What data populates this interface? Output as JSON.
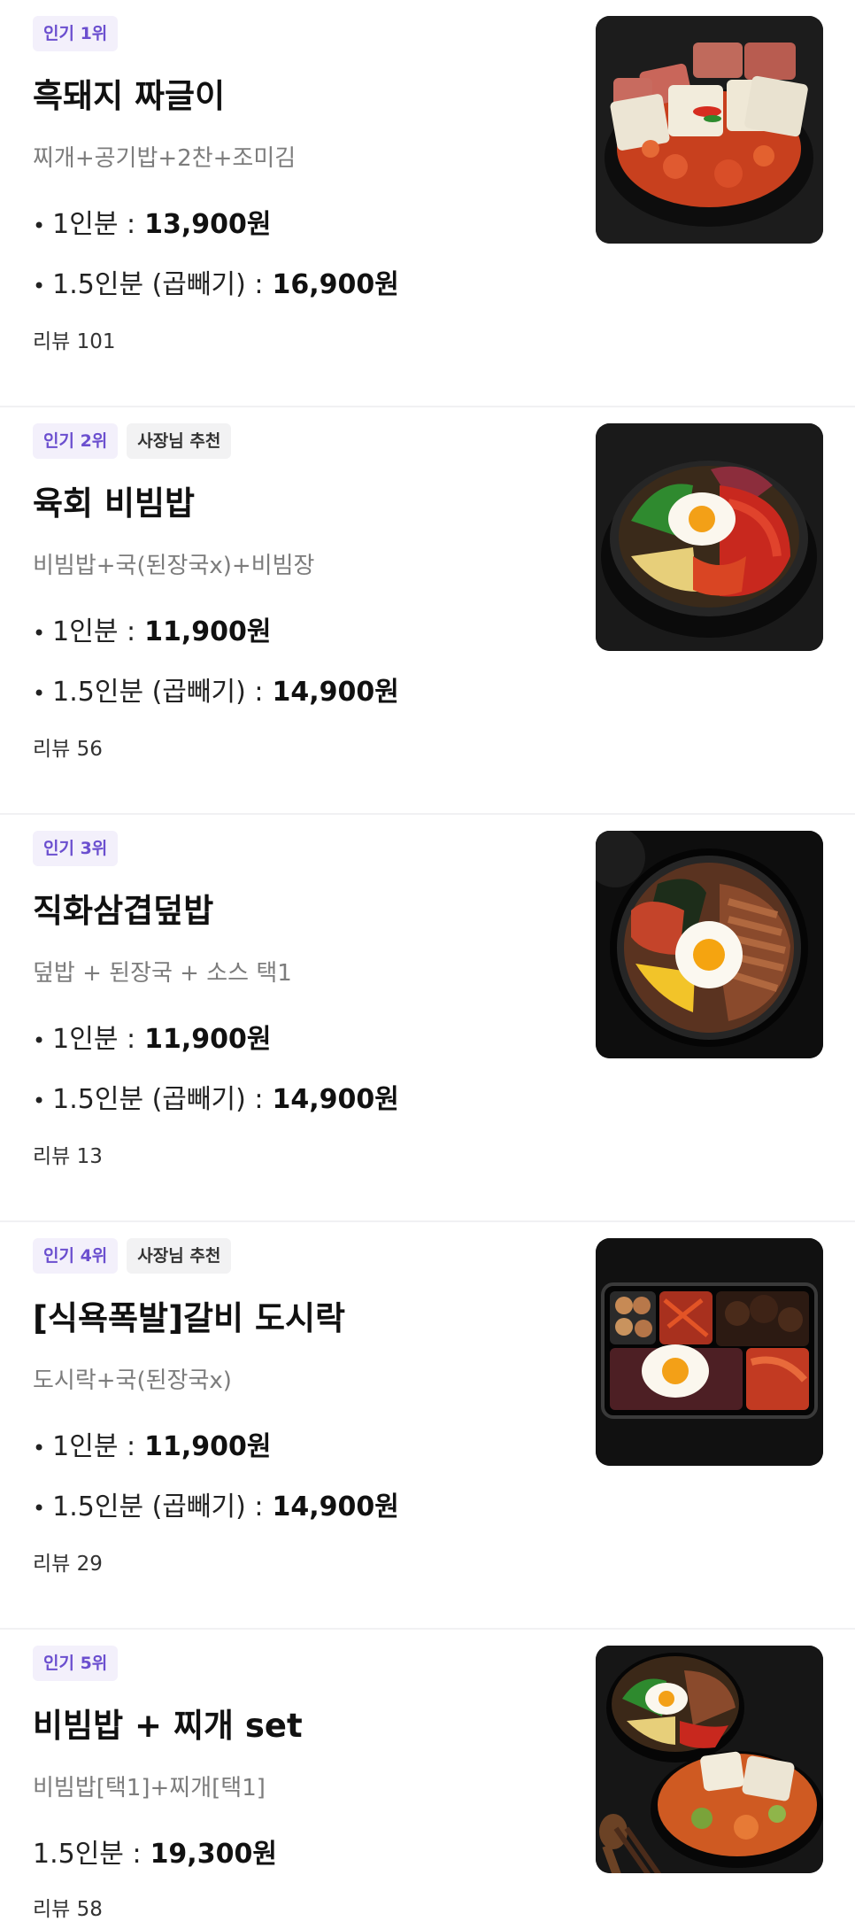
{
  "items": [
    {
      "badges": [
        "인기 1위"
      ],
      "title": "흑돼지 짜글이",
      "description": "찌개+공기밥+2찬+조미김",
      "prices": [
        {
          "label": "1인분 :",
          "amount": "13,900원"
        },
        {
          "label": "1.5인분 (곱빼기) :",
          "amount": "16,900원"
        }
      ],
      "reviews": "리뷰 101",
      "image_icon": "jjageuli-stew-photo"
    },
    {
      "badges": [
        "인기 2위",
        "사장님 추천"
      ],
      "title": "육회 비빔밥",
      "description": "비빔밥+국(된장국x)+비빔장",
      "prices": [
        {
          "label": "1인분 :",
          "amount": "11,900원"
        },
        {
          "label": "1.5인분 (곱빼기) :",
          "amount": "14,900원"
        }
      ],
      "reviews": "리뷰 56",
      "image_icon": "bibimbap-photo"
    },
    {
      "badges": [
        "인기 3위"
      ],
      "title": "직화삼겹덮밥",
      "description": "덮밥 + 된장국 + 소스 택1",
      "prices": [
        {
          "label": "1인분 :",
          "amount": "11,900원"
        },
        {
          "label": "1.5인분 (곱빼기) :",
          "amount": "14,900원"
        }
      ],
      "reviews": "리뷰 13",
      "image_icon": "pork-rice-bowl-photo"
    },
    {
      "badges": [
        "인기 4위",
        "사장님 추천"
      ],
      "title": "[식욕폭발]갈비 도시락",
      "description": "도시락+국(된장국x)",
      "prices": [
        {
          "label": "1인분 :",
          "amount": "11,900원"
        },
        {
          "label": "1.5인분 (곱빼기) :",
          "amount": "14,900원"
        }
      ],
      "reviews": "리뷰 29",
      "image_icon": "galbi-lunchbox-photo"
    },
    {
      "badges": [
        "인기 5위"
      ],
      "title": "비빔밥 + 찌개 set",
      "description": "비빔밥[택1]+찌개[택1]",
      "prices": [
        {
          "label": "1.5인분 :",
          "amount": "19,300원"
        }
      ],
      "reviews": "리뷰 58",
      "image_icon": "bibimbap-stew-set-photo"
    }
  ]
}
